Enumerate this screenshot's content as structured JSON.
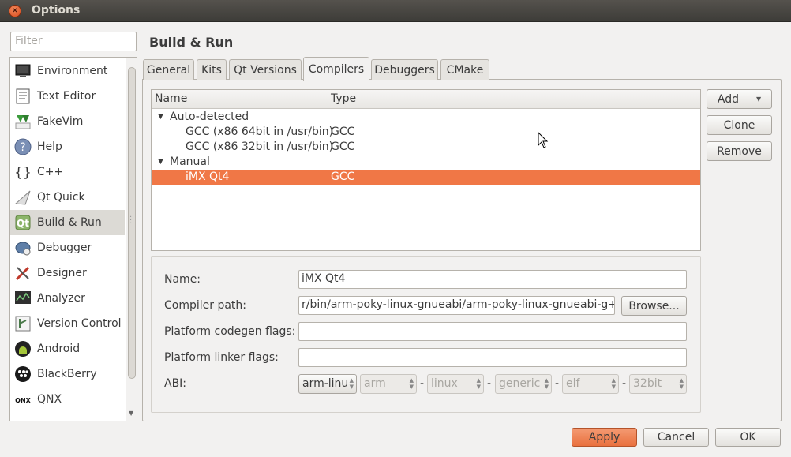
{
  "window": {
    "title": "Options",
    "close_glyph": "×"
  },
  "filter": {
    "placeholder": "Filter"
  },
  "sidebar": {
    "items": [
      {
        "label": "Environment",
        "icon": "monitor-icon"
      },
      {
        "label": "Text Editor",
        "icon": "text-editor-icon"
      },
      {
        "label": "FakeVim",
        "icon": "fakevim-icon"
      },
      {
        "label": "Help",
        "icon": "help-icon"
      },
      {
        "label": "C++",
        "icon": "cpp-braces-icon"
      },
      {
        "label": "Qt Quick",
        "icon": "qt-quick-icon"
      },
      {
        "label": "Build & Run",
        "icon": "build-run-icon"
      },
      {
        "label": "Debugger",
        "icon": "debugger-icon"
      },
      {
        "label": "Designer",
        "icon": "designer-icon"
      },
      {
        "label": "Analyzer",
        "icon": "analyzer-icon"
      },
      {
        "label": "Version Control",
        "icon": "version-control-icon"
      },
      {
        "label": "Android",
        "icon": "android-icon"
      },
      {
        "label": "BlackBerry",
        "icon": "blackberry-icon"
      },
      {
        "label": "QNX",
        "icon": "qnx-icon"
      }
    ],
    "selected": "Build & Run"
  },
  "page": {
    "title": "Build & Run"
  },
  "tabs": [
    "General",
    "Kits",
    "Qt Versions",
    "Compilers",
    "Debuggers",
    "CMake"
  ],
  "active_tab": "Compilers",
  "tree": {
    "columns": [
      "Name",
      "Type"
    ],
    "groups": [
      {
        "label": "Auto-detected",
        "rows": [
          {
            "name": "GCC (x86 64bit in /usr/bin)",
            "type": "GCC"
          },
          {
            "name": "GCC (x86 32bit in /usr/bin)",
            "type": "GCC"
          }
        ]
      },
      {
        "label": "Manual",
        "rows": [
          {
            "name": "iMX Qt4",
            "type": "GCC"
          }
        ]
      }
    ],
    "selected_row": "iMX Qt4"
  },
  "side_buttons": {
    "add": "Add",
    "clone": "Clone",
    "remove": "Remove"
  },
  "form": {
    "name_label": "Name:",
    "name_value": "iMX Qt4",
    "compiler_path_label": "Compiler path:",
    "compiler_path_value": "r/bin/arm-poky-linux-gnueabi/arm-poky-linux-gnueabi-g++",
    "browse_label": "Browse...",
    "codegen_label": "Platform codegen flags:",
    "codegen_value": "",
    "linker_label": "Platform linker flags:",
    "linker_value": "",
    "abi_label": "ABI:",
    "abi_values": [
      "arm-linu",
      "arm",
      "linux",
      "generic",
      "elf",
      "32bit"
    ],
    "abi_separator": "-"
  },
  "footer": {
    "apply": "Apply",
    "cancel": "Cancel",
    "ok": "OK"
  },
  "colors": {
    "accent": "#f07746",
    "apply": "#e9703e"
  }
}
